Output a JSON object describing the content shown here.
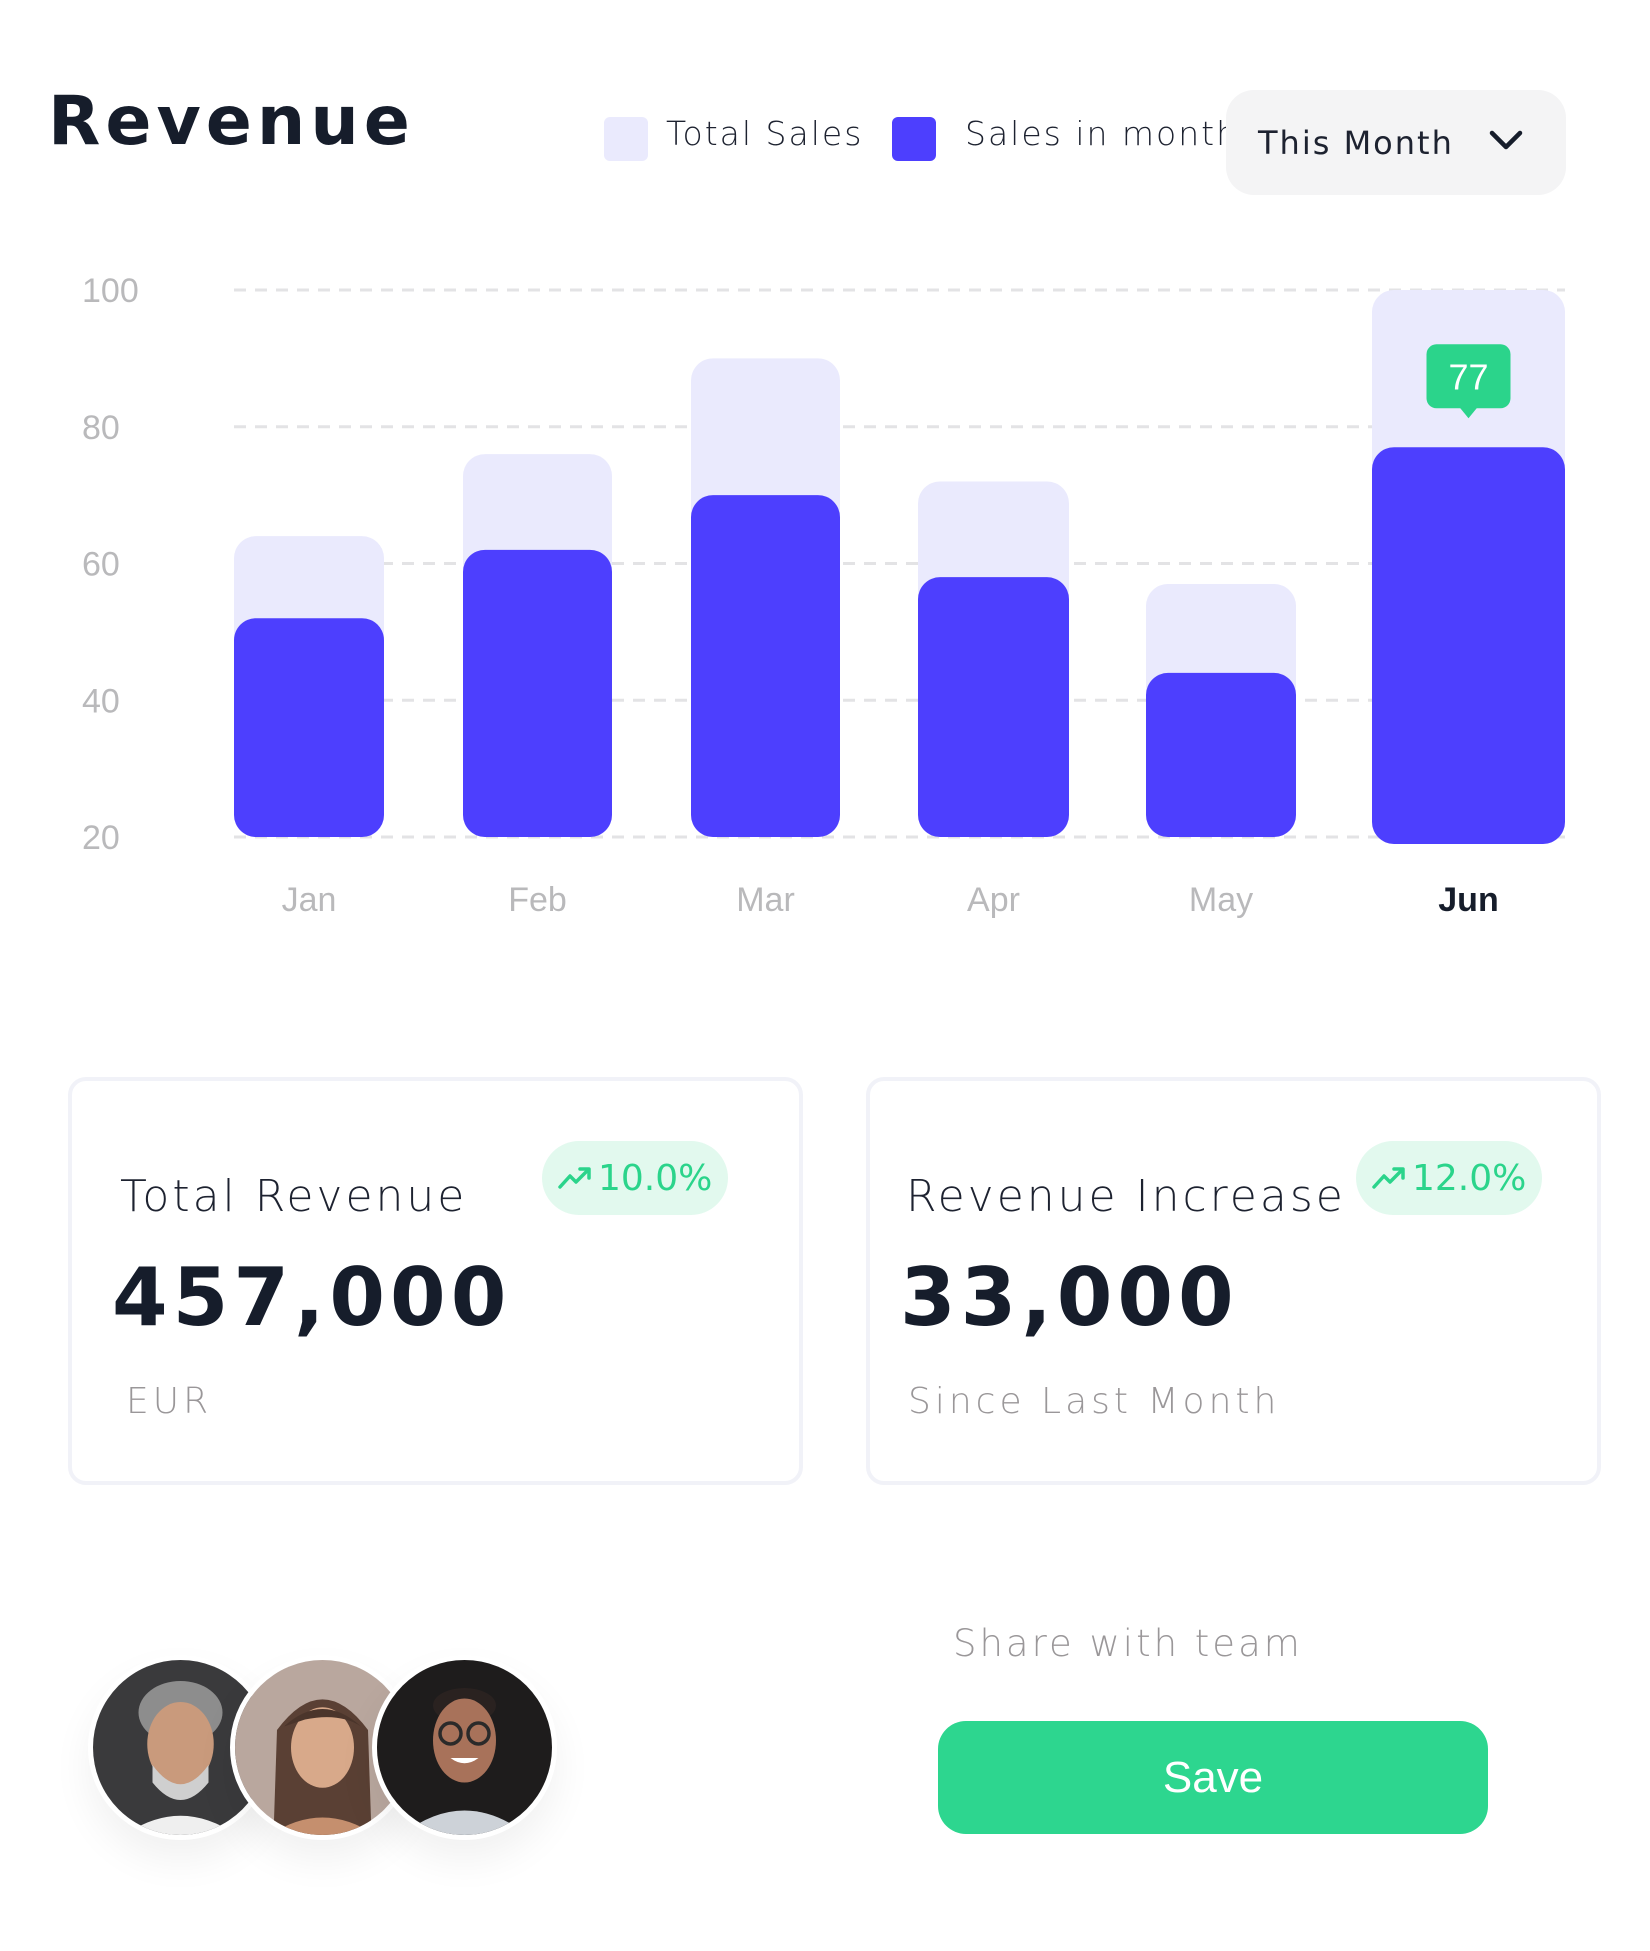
{
  "header": {
    "title": "Revenue",
    "legend": [
      {
        "label": "Total Sales",
        "color": "#eaeafd"
      },
      {
        "label": "Sales in month",
        "color": "#4d3ffe"
      }
    ],
    "period_dropdown": {
      "selected": "This Month",
      "icon": "chevron-down-icon"
    }
  },
  "chart_data": {
    "type": "bar",
    "title": "Revenue",
    "categories": [
      "Jan",
      "Feb",
      "Mar",
      "Apr",
      "May",
      "Jun"
    ],
    "series": [
      {
        "name": "Total Sales",
        "values": [
          64,
          76,
          90,
          72,
          57,
          100
        ],
        "color": "#eaeafd"
      },
      {
        "name": "Sales in month",
        "values": [
          52,
          62,
          70,
          58,
          44,
          77
        ],
        "color": "#4d3ffe"
      }
    ],
    "yticks": [
      100,
      80,
      60,
      40,
      20
    ],
    "ylim": [
      20,
      100
    ],
    "xlabel": "",
    "ylabel": "",
    "grid": true,
    "legend_position": "top-right",
    "highlighted_category": "Jun",
    "annotation": {
      "category": "Jun",
      "series": "Sales in month",
      "label": "77",
      "color": "#2bd48b"
    }
  },
  "cards": [
    {
      "title": "Total Revenue",
      "value": "457,000",
      "subtitle": "EUR",
      "badge": "10.0%",
      "badge_icon": "trending-up-icon"
    },
    {
      "title": "Revenue Increase",
      "value": "33,000",
      "subtitle": "Since Last Month",
      "badge": "12.0%",
      "badge_icon": "trending-up-icon"
    }
  ],
  "team": {
    "avatars": [
      {
        "name": "team-member-1"
      },
      {
        "name": "team-member-2"
      },
      {
        "name": "team-member-3"
      }
    ],
    "share_label": "Share with team",
    "save_label": "Save"
  }
}
